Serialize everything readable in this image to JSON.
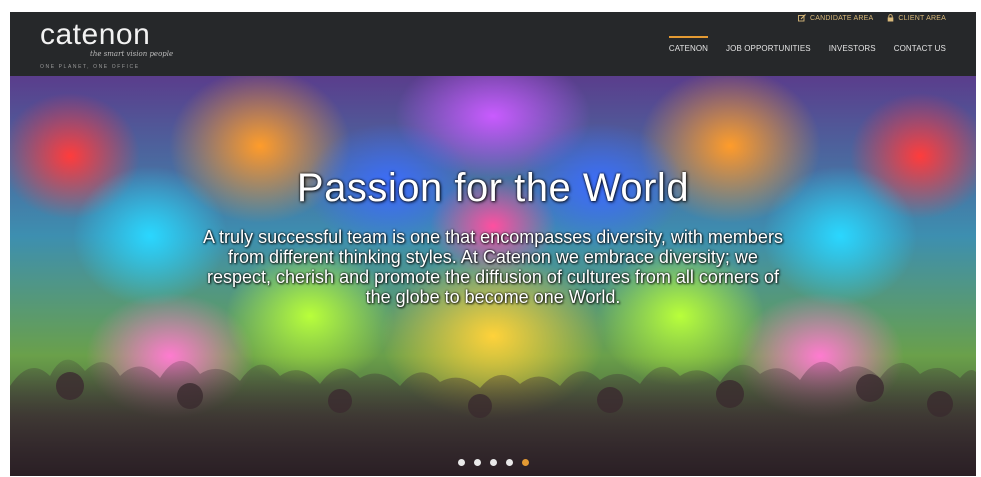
{
  "header": {
    "logo_text": "catenon",
    "logo_tagline": "the smart vision people",
    "logo_subline": "ONE PLANET, ONE OFFICE",
    "utility_links": [
      {
        "label": "CANDIDATE AREA",
        "icon": "edit-icon"
      },
      {
        "label": "CLIENT AREA",
        "icon": "lock-icon"
      }
    ],
    "nav": [
      {
        "label": "CATENON",
        "active": true
      },
      {
        "label": "JOB OPPORTUNITIES",
        "active": false
      },
      {
        "label": "INVESTORS",
        "active": false
      },
      {
        "label": "CONTACT US",
        "active": false
      }
    ],
    "accent_color": "#e39a33"
  },
  "hero": {
    "title": "Passion for the World",
    "body": "A truly successful team is one that encompasses diversity, with members from different thinking styles. At Catenon we embrace diversity; we respect, cherish and promote the diffusion of cultures from all corners of the globe to become one World.",
    "slides_total": 5,
    "active_slide": 5
  }
}
